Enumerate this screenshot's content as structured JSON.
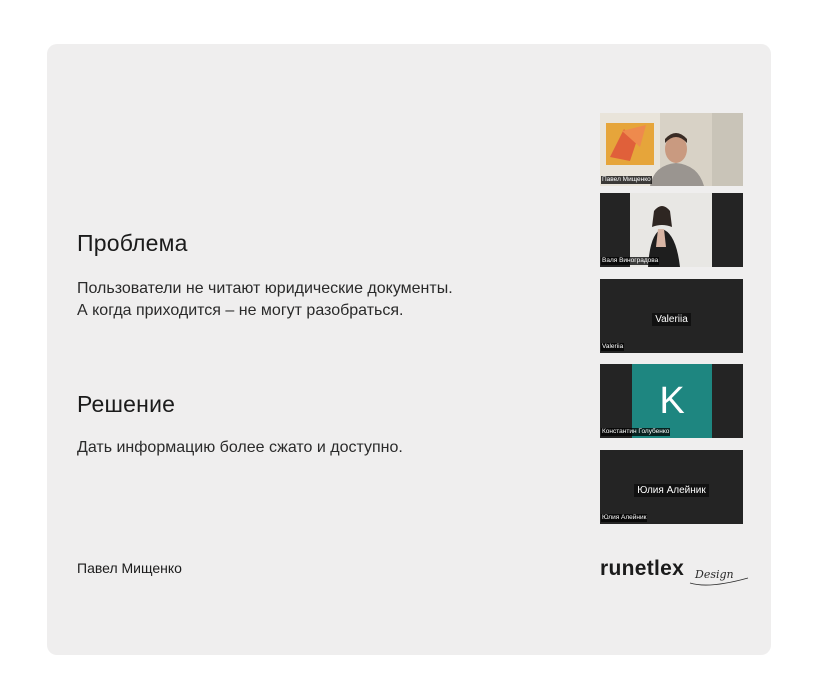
{
  "slide": {
    "problem": {
      "title": "Проблема",
      "line1": "Пользователи не читают юридические документы.",
      "line2": "А когда приходится – не могут разобраться."
    },
    "solution": {
      "title": "Решение",
      "text": "Дать информацию более сжато и доступно."
    },
    "author": "Павел Мищенко",
    "logo": {
      "main": "runetlex",
      "script": "Design"
    }
  },
  "participants": [
    {
      "name": "Павел Мищенко",
      "tile_type": "video"
    },
    {
      "name": "Валя Виноградова",
      "tile_type": "video"
    },
    {
      "name": "Valeriia",
      "center_label": "Valeriia",
      "tile_type": "name-only"
    },
    {
      "name": "Константин Голубенко",
      "avatar_letter": "K",
      "avatar_color": "#1e8680",
      "tile_type": "avatar"
    },
    {
      "name": "Юлия Алейник",
      "center_label": "Юлия Алейник",
      "tile_type": "name-only"
    }
  ],
  "colors": {
    "slide_background": "#efeeee",
    "tile_background": "#242424",
    "avatar_teal": "#1e8680"
  }
}
